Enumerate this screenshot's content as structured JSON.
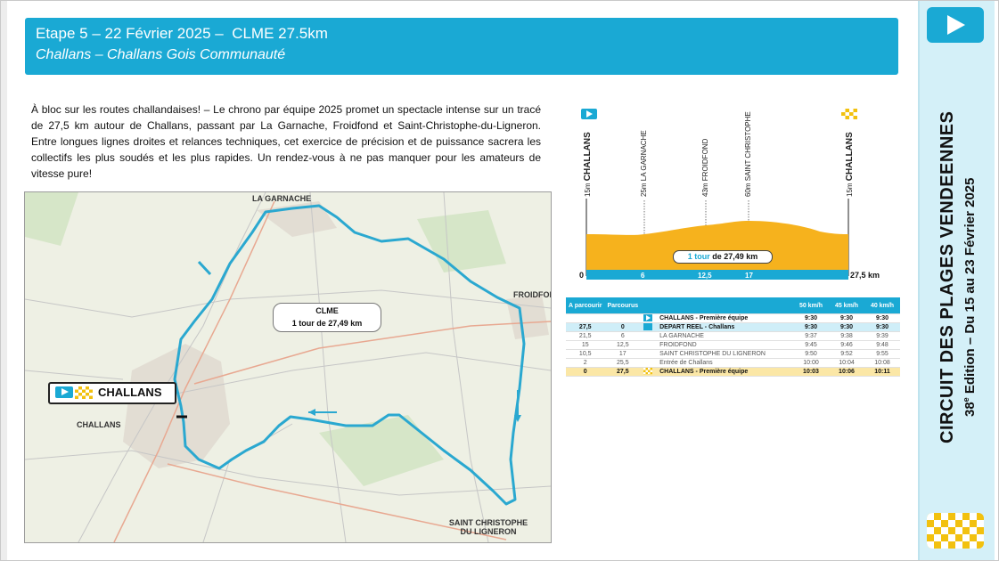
{
  "header": {
    "line1": "Etape 5 – 22 Février 2025 –  CLME 27.5km",
    "line2": "Challans – Challans Gois Communauté"
  },
  "description": "À bloc sur les routes challandaises! – Le chrono par équipe 2025 promet un spectacle intense sur un tracé de 27,5 km autour de Challans, passant par La Garnache, Froidfond et Saint-Christophe-du-Ligneron. Entre longues lignes droites et relances techniques, cet exercice de précision et de puissance sacrera les collectifs les plus soudés et les plus rapides. Un rendez-vous à ne pas manquer pour les amateurs de vitesse pure!",
  "map": {
    "labels": {
      "la_garnache": "LA GARNACHE",
      "froidfond": "FROIDFOND",
      "challans_town": "CHALLANS",
      "saint_christophe_1": "SAINT CHRISTOPHE",
      "saint_christophe_2": "DU LIGNERON"
    },
    "clme_title": "CLME",
    "clme_sub": "1 tour de 27,49 km",
    "start_tag": "CHALLANS"
  },
  "profile": {
    "points": [
      {
        "alt": "15m",
        "name": "CHALLANS"
      },
      {
        "alt": "25m",
        "name": "LA GARNACHE"
      },
      {
        "alt": "43m",
        "name": "FROIDFOND"
      },
      {
        "alt": "60m",
        "name": "SAINT CHRISTOPHE"
      },
      {
        "alt": "15m",
        "name": "CHALLANS"
      }
    ],
    "tour_prefix": "1 tour",
    "tour_suffix": " de 27,49 km",
    "ticks": [
      "0",
      "6",
      "12,5",
      "17",
      "27,5 km"
    ]
  },
  "timetable": {
    "headers": {
      "a": "A parcourir",
      "p": "Parcourus",
      "s1": "50 km/h",
      "s2": "45 km/h",
      "s3": "40 km/h"
    },
    "rows": [
      {
        "a": "",
        "p": "",
        "icon": "play",
        "name": "CHALLANS - Première équipe",
        "t1": "9:30",
        "t2": "9:30",
        "t3": "9:30",
        "style": "bold"
      },
      {
        "a": "27,5",
        "p": "0",
        "icon": "km",
        "name": "DEPART REEL - Challans",
        "t1": "9:30",
        "t2": "9:30",
        "t3": "9:30",
        "style": "hi"
      },
      {
        "a": "21,5",
        "p": "6",
        "icon": "",
        "name": "LA GARNACHE",
        "t1": "9:37",
        "t2": "9:38",
        "t3": "9:39",
        "style": "gray"
      },
      {
        "a": "15",
        "p": "12,5",
        "icon": "",
        "name": "FROIDFOND",
        "t1": "9:45",
        "t2": "9:46",
        "t3": "9:48",
        "style": "gray"
      },
      {
        "a": "10,5",
        "p": "17",
        "icon": "",
        "name": "SAINT CHRISTOPHE DU LIGNERON",
        "t1": "9:50",
        "t2": "9:52",
        "t3": "9:55",
        "style": "gray"
      },
      {
        "a": "2",
        "p": "25,5",
        "icon": "",
        "name": "Entrée de Challans",
        "t1": "10:00",
        "t2": "10:04",
        "t3": "10:08",
        "style": "gray"
      },
      {
        "a": "0",
        "p": "27,5",
        "icon": "flag",
        "name": "CHALLANS - Première équipe",
        "t1": "10:03",
        "t2": "10:06",
        "t3": "10:11",
        "style": "final"
      }
    ]
  },
  "side": {
    "title": "CIRCUIT DES PLAGES VENDEENNES",
    "edition_num": "38",
    "edition_sup": "e",
    "edition_rest": " Edition – Du 15 au 23 Février 2025"
  },
  "colors": {
    "accent": "#1aa9d4",
    "profile_fill": "#f6b21d",
    "route": "#2aa8d0",
    "flag_yellow": "#f2c10f"
  }
}
